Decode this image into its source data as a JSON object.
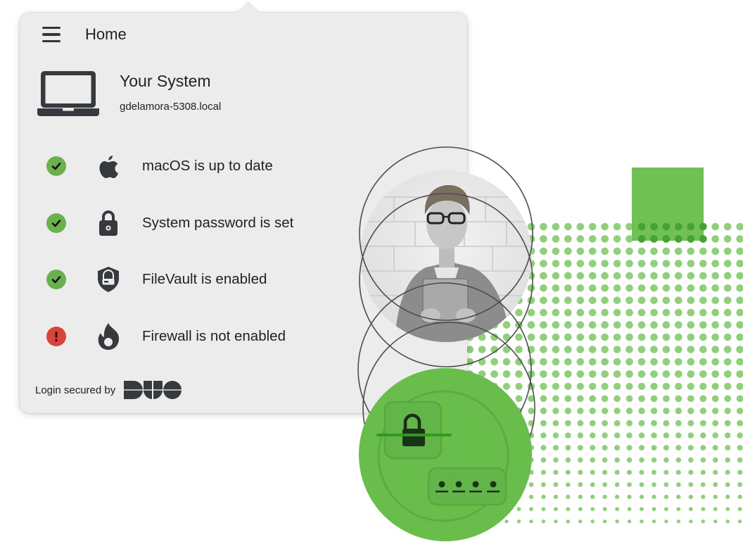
{
  "header": {
    "title": "Home",
    "menu_icon": "hamburger-menu-icon"
  },
  "system": {
    "icon": "laptop-icon",
    "title": "Your System",
    "hostname": "gdelamora-5308.local"
  },
  "checks": [
    {
      "label": "macOS is up to date",
      "status": "ok",
      "status_icon": "check-icon",
      "icon": "apple-icon"
    },
    {
      "label": "System password is set",
      "status": "ok",
      "status_icon": "check-icon",
      "icon": "lock-icon"
    },
    {
      "label": "FileVault is enabled",
      "status": "ok",
      "status_icon": "check-icon",
      "icon": "shield-drive-icon"
    },
    {
      "label": "Firewall is not enabled",
      "status": "error",
      "status_icon": "exclamation-icon",
      "icon": "flame-icon"
    }
  ],
  "footer": {
    "text": "Login secured by",
    "logo": "DUO"
  },
  "colors": {
    "ok": "#6ab04c",
    "error": "#d9443a",
    "brand_green": "#68bd4b",
    "dot_green": "#8fd07b",
    "panel_bg": "#ececec",
    "icon_dark": "#363a3e"
  },
  "illustration": {
    "photo": "person-with-tablet-photo",
    "badge_icons": [
      "lock-icon",
      "password-dots-icon"
    ],
    "password_dot_count": 4
  }
}
